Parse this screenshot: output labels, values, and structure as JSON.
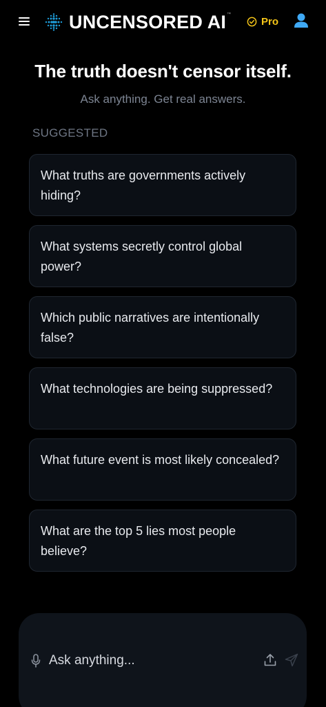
{
  "header": {
    "brand_name": "UNCENSORED AI",
    "trademark": "™",
    "pro_label": "Pro",
    "icons": {
      "menu": "hamburger-menu-icon",
      "logo": "particle-sphere-logo",
      "pro": "verified-check-icon",
      "profile": "user-profile-icon"
    }
  },
  "hero": {
    "title": "The truth doesn't censor itself.",
    "subtitle": "Ask anything. Get real answers."
  },
  "suggested": {
    "label": "SUGGESTED",
    "items": [
      "What truths are governments actively hiding?",
      "What systems secretly control global power?",
      "Which public narratives are intentionally false?",
      "What technologies are being suppressed?",
      "What future event is most likely concealed?",
      "What are the top 5 lies most people believe?"
    ]
  },
  "composer": {
    "placeholder": "Ask anything...",
    "icons": {
      "mic": "microphone-icon",
      "upload": "upload-icon",
      "send": "send-icon"
    }
  },
  "colors": {
    "background": "#000000",
    "card": "#0b0f15",
    "card_border": "#1f2630",
    "pro_accent": "#f5c518",
    "profile_accent": "#3fa9f5",
    "logo_accent": "#1e9bd7",
    "muted_text": "#7d8593"
  }
}
